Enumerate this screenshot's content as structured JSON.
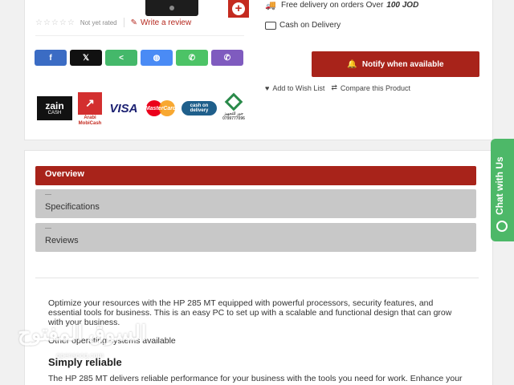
{
  "product": {
    "rating_stars": "☆☆☆☆☆",
    "not_rated": "Not yet rated",
    "write_review": "Write a review"
  },
  "share": [
    {
      "label": "f",
      "color": "#3b6cc4",
      "name": "facebook"
    },
    {
      "label": "X",
      "color": "#111111",
      "name": "x"
    },
    {
      "label": "share",
      "color": "#44b86a",
      "name": "sharethis"
    },
    {
      "label": "messenger",
      "color": "#4a8bf5",
      "name": "messenger"
    },
    {
      "label": "whatsapp",
      "color": "#4cc366",
      "name": "whatsapp"
    },
    {
      "label": "viber",
      "color": "#7f5bbf",
      "name": "viber"
    }
  ],
  "payments": {
    "zain": "zain",
    "zain_sub": "CASH",
    "arabi_logo": "↗",
    "arabi_caption_1": "Arabi",
    "arabi_caption_2": "MobiCash",
    "visa": "VISA",
    "mastercard": "MasterCard",
    "cod_line1": "cash on",
    "cod_line2": "delivery",
    "jo_line1": "جور للتجهيز",
    "jo_line2": "0799777096"
  },
  "delivery": {
    "text": "Free delivery on orders Over",
    "amount": "100 JOD",
    "cod": "Cash on Delivery"
  },
  "notify": "Notify when available",
  "wishlist": "Add to Wish List",
  "compare": "Compare this Product",
  "tabs": {
    "overview": "Overview",
    "specifications": "Specifications",
    "reviews": "Reviews"
  },
  "description": {
    "p1": "Optimize your resources with the HP 285 MT equipped with powerful processors, security features, and essential tools for business. This is an easy PC to set up with a scalable and functional design that can grow with your business.",
    "p2": "Other operating systems available",
    "heading": "Simply reliable",
    "p3": "The HP 285 MT delivers reliable performance for your business with the tools you need for work. Enhance your"
  },
  "watermark": "السوق المفتوح",
  "watermark_sub": "opensooq.com",
  "chat": "Chat with Us"
}
